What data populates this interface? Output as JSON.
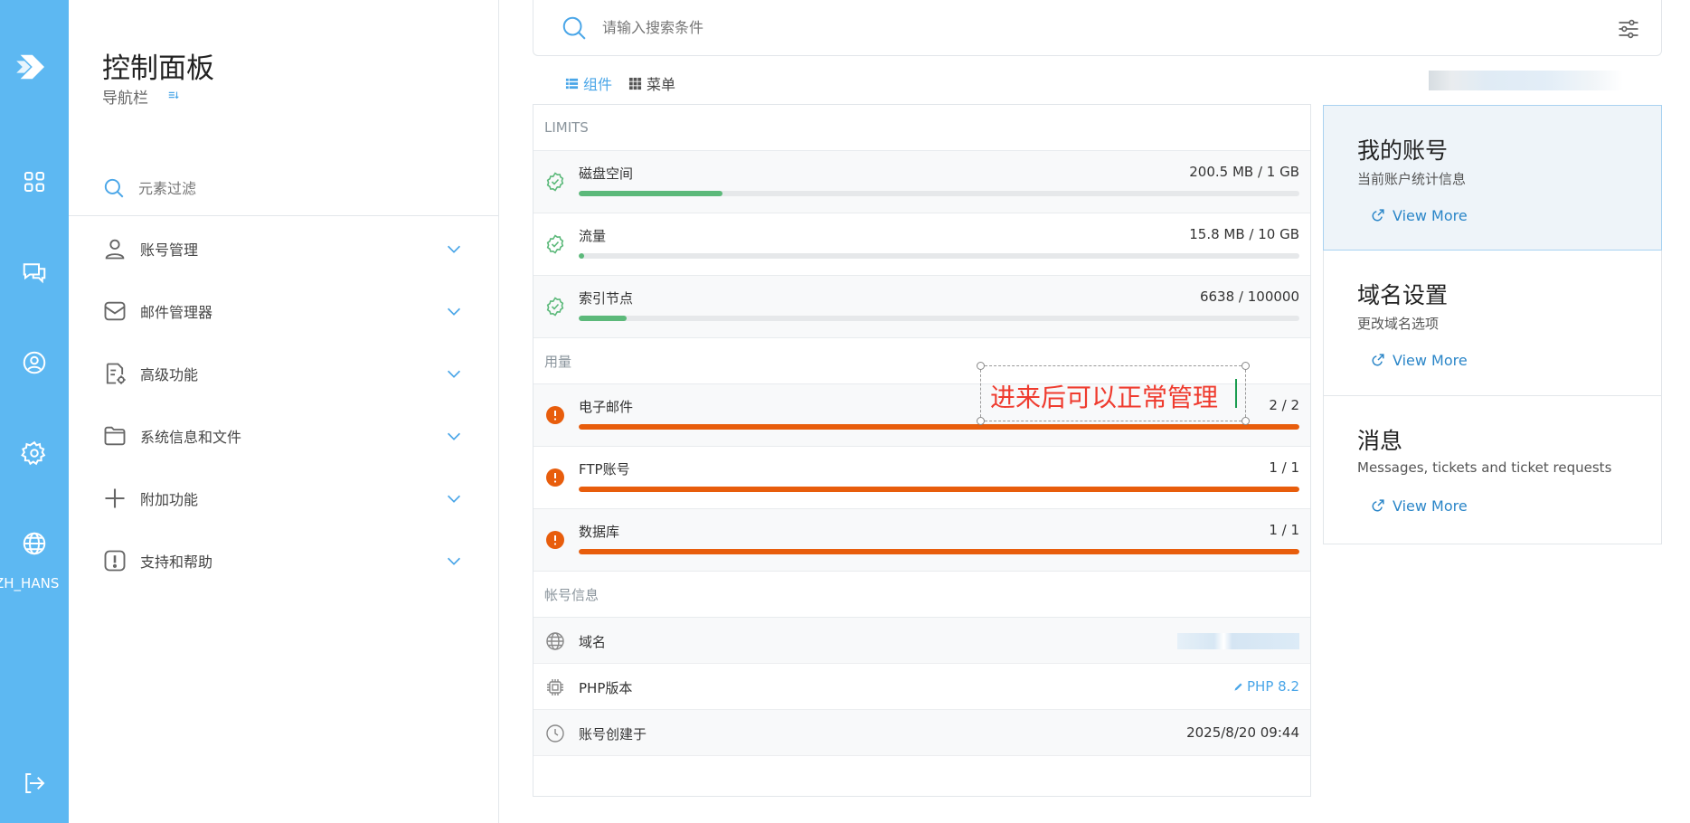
{
  "rail": {
    "lang_label": "ZH_HANS",
    "icons": [
      "logo-icon",
      "grid-icon",
      "chat-icon",
      "user-circle-icon",
      "gear-icon",
      "globe-icon",
      "logout-icon"
    ]
  },
  "nav": {
    "title": "控制面板",
    "subtitle": "导航栏",
    "filter_placeholder": "元素过滤",
    "items": [
      {
        "label": "账号管理",
        "icon": "user-icon"
      },
      {
        "label": "邮件管理器",
        "icon": "mail-icon"
      },
      {
        "label": "高级功能",
        "icon": "advanced-file-icon"
      },
      {
        "label": "系统信息和文件",
        "icon": "folder-icon"
      },
      {
        "label": "附加功能",
        "icon": "plus-icon"
      },
      {
        "label": "支持和帮助",
        "icon": "alert-square-icon"
      }
    ]
  },
  "search": {
    "placeholder": "请输入搜索条件"
  },
  "view_toggle": {
    "widgets": "组件",
    "menu": "菜单"
  },
  "limits": {
    "header": "LIMITS",
    "rows": [
      {
        "label": "磁盘空间",
        "value": "200.5 MB / 1 GB",
        "progress": 0.2,
        "status": "ok"
      },
      {
        "label": "流量",
        "value": "15.8 MB / 10 GB",
        "progress": 0.008,
        "status": "ok"
      },
      {
        "label": "索引节点",
        "value": "6638 / 100000",
        "progress": 0.066,
        "status": "ok"
      }
    ],
    "usage_header": "用量",
    "usage_rows": [
      {
        "label": "电子邮件",
        "value": "2 / 2",
        "progress": 1.0,
        "status": "full"
      },
      {
        "label": "FTP账号",
        "value": "1 / 1",
        "progress": 1.0,
        "status": "full"
      },
      {
        "label": "数据库",
        "value": "1 / 1",
        "progress": 1.0,
        "status": "full"
      }
    ],
    "account_header": "帐号信息",
    "account_rows": [
      {
        "label": "域名",
        "value": ""
      },
      {
        "label": "PHP版本",
        "value": "PHP 8.2"
      },
      {
        "label": "账号创建于",
        "value": "2025/8/20 09:44"
      }
    ]
  },
  "annotation": {
    "text": "进来后可以正常管理"
  },
  "cards": [
    {
      "title": "我的账号",
      "subtitle": "当前账户统计信息",
      "link": "View More"
    },
    {
      "title": "域名设置",
      "subtitle": "更改域名选项",
      "link": "View More"
    },
    {
      "title": "消息",
      "subtitle": "Messages, tickets and ticket requests",
      "link": "View More"
    }
  ],
  "colors": {
    "rail": "#5db8f2",
    "accent": "#4aa6e8",
    "ok_green": "#5cb97a",
    "full_orange": "#e85d0c",
    "annotation_red": "#ef3b2e"
  }
}
